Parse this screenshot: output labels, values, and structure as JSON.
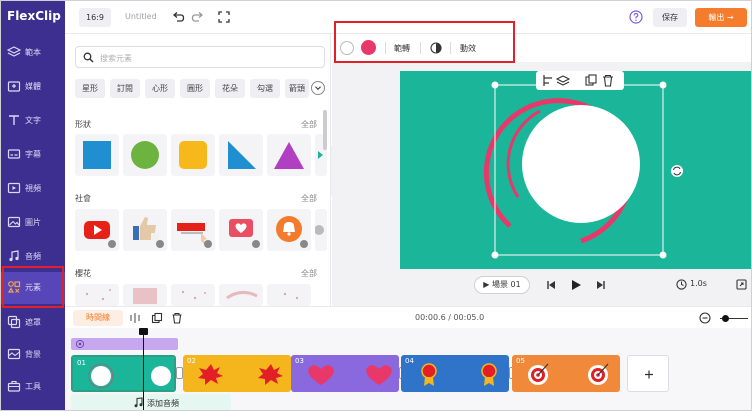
{
  "app": {
    "logo_text": "FlexClip"
  },
  "sidebar": {
    "items": [
      {
        "label": "範本",
        "icon": "layers-icon"
      },
      {
        "label": "媒體",
        "icon": "media-folder-icon"
      },
      {
        "label": "文字",
        "icon": "text-icon"
      },
      {
        "label": "字幕",
        "icon": "subtitles-icon"
      },
      {
        "label": "視頻",
        "icon": "video-icon"
      },
      {
        "label": "圖片",
        "icon": "image-icon"
      },
      {
        "label": "音頻",
        "icon": "music-icon"
      },
      {
        "label": "元素",
        "icon": "elements-icon"
      },
      {
        "label": "遮罩",
        "icon": "overlay-icon"
      },
      {
        "label": "背景",
        "icon": "background-icon"
      },
      {
        "label": "工具",
        "icon": "toolbox-icon"
      }
    ],
    "active_label": "元素"
  },
  "topbar": {
    "ratio": "16:9",
    "project_name": "Untitled",
    "save_label": "保存",
    "export_label": "輸出 →"
  },
  "panel": {
    "search_placeholder": "搜索元素",
    "chips": [
      "星形",
      "訂閱",
      "心形",
      "圓形",
      "花朵",
      "勾選",
      "箭頭"
    ],
    "sections": [
      {
        "title": "形狀",
        "all": "全部"
      },
      {
        "title": "社會",
        "all": "全部"
      },
      {
        "title": "櫻花",
        "all": "全部"
      }
    ]
  },
  "context_toolbar": {
    "fill_color": "#e8386a",
    "range_label": "範轉",
    "animation_label": "動效"
  },
  "player": {
    "scene_label": "▶ 場景 01",
    "duration": "1.0s"
  },
  "timeline": {
    "button_label": "時間線",
    "timecode": "00:00.6 / 00:05.0",
    "clips": [
      {
        "num": "01",
        "color": "#1bb59a"
      },
      {
        "num": "02",
        "color": "#f5b51c"
      },
      {
        "num": "03",
        "color": "#8a68de"
      },
      {
        "num": "04",
        "color": "#2f74c9"
      },
      {
        "num": "05",
        "color": "#f08a3a"
      }
    ],
    "add_audio_label": "添加音頻"
  }
}
